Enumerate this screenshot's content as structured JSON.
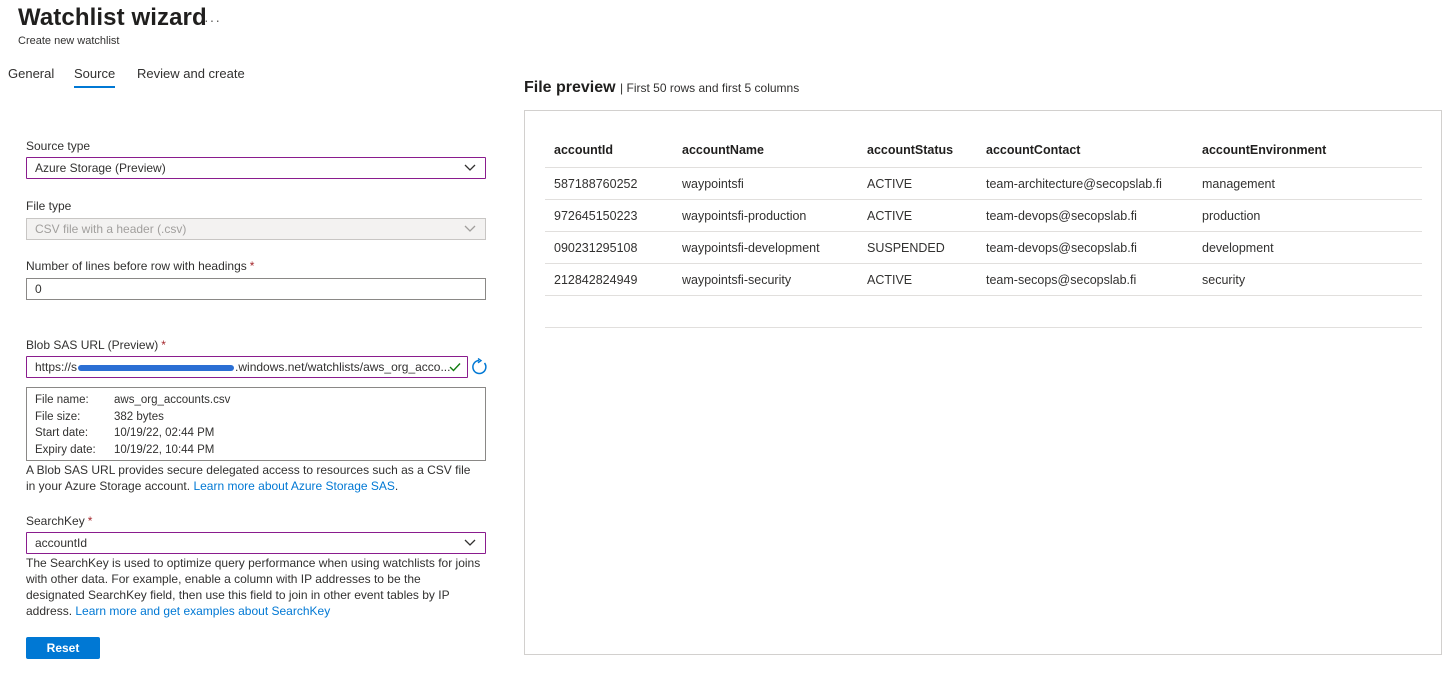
{
  "header": {
    "title": "Watchlist wizard",
    "more_icon": "more-icon",
    "subtitle": "Create new watchlist"
  },
  "tabs": [
    {
      "label": "General",
      "active": false
    },
    {
      "label": "Source",
      "active": true
    },
    {
      "label": "Review and create",
      "active": false
    }
  ],
  "form": {
    "source_type": {
      "label": "Source type",
      "value": "Azure Storage (Preview)"
    },
    "file_type": {
      "label": "File type",
      "value": "CSV file with a header (.csv)"
    },
    "lines_before": {
      "label": "Number of lines before row with headings",
      "required_mark": "*",
      "value": "0"
    },
    "blob_url": {
      "label": "Blob SAS URL (Preview)",
      "required_mark": "*",
      "value_start": "https://s",
      "value_end": ".windows.net/watchlists/aws_org_acco...",
      "redaction_color": "#2b6fd4"
    },
    "file_info": [
      {
        "key": "File name:",
        "value": "aws_org_accounts.csv"
      },
      {
        "key": "File size:",
        "value": "382 bytes"
      },
      {
        "key": "Start date:",
        "value": "10/19/22, 02:44 PM"
      },
      {
        "key": "Expiry date:",
        "value": "10/19/22, 10:44 PM"
      }
    ],
    "blob_help": {
      "text": "A Blob SAS URL provides secure delegated access to resources such as a CSV file in your Azure Storage account.",
      "link": "Learn more about Azure Storage SAS",
      "end": "."
    },
    "search_key": {
      "label": "SearchKey",
      "required_mark": "*",
      "value": "accountId"
    },
    "search_help": {
      "text": "The SearchKey is used to optimize query performance when using watchlists for joins with other data. For example, enable a column with IP addresses to be the designated SearchKey field, then use this field to join in other event tables by IP address.",
      "link": "Learn more and get examples about SearchKey"
    },
    "reset_label": "Reset"
  },
  "preview": {
    "title": "File preview",
    "subtitle": "| First 50 rows and first 5 columns",
    "columns": [
      "accountId",
      "accountName",
      "accountStatus",
      "accountContact",
      "accountEnvironment"
    ],
    "rows": [
      [
        "587188760252",
        "waypointsfi",
        "ACTIVE",
        "team-architecture@secopslab.fi",
        "management"
      ],
      [
        "972645150223",
        "waypointsfi-production",
        "ACTIVE",
        "team-devops@secopslab.fi",
        "production"
      ],
      [
        "090231295108",
        "waypointsfi-development",
        "SUSPENDED",
        "team-devops@secopslab.fi",
        "development"
      ],
      [
        "212842824949",
        "waypointsfi-security",
        "ACTIVE",
        "team-secops@secopslab.fi",
        "security"
      ]
    ]
  },
  "colors": {
    "accent": "#0078d4",
    "focus_border": "#8a1c8e",
    "required": "#a4262c",
    "valid_check": "#107c10"
  }
}
